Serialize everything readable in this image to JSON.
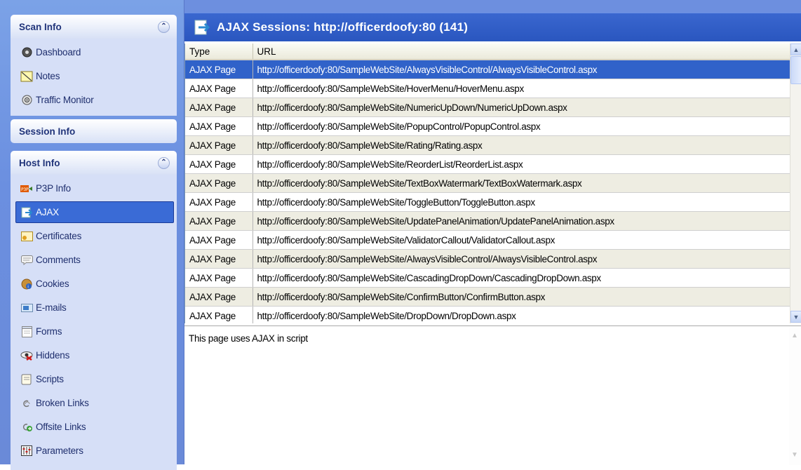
{
  "sidebar": {
    "scan_info": {
      "title": "Scan Info",
      "items": [
        {
          "label": "Dashboard",
          "icon": "dashboard-icon"
        },
        {
          "label": "Notes",
          "icon": "notes-icon"
        },
        {
          "label": "Traffic Monitor",
          "icon": "traffic-monitor-icon"
        }
      ]
    },
    "session_info": {
      "title": "Session Info"
    },
    "host_info": {
      "title": "Host Info",
      "selected": "AJAX",
      "items": [
        {
          "label": "P3P Info",
          "icon": "p3p-icon"
        },
        {
          "label": "AJAX",
          "icon": "ajax-icon"
        },
        {
          "label": "Certificates",
          "icon": "certificate-icon"
        },
        {
          "label": "Comments",
          "icon": "comment-icon"
        },
        {
          "label": "Cookies",
          "icon": "cookie-icon"
        },
        {
          "label": "E-mails",
          "icon": "email-icon"
        },
        {
          "label": "Forms",
          "icon": "form-icon"
        },
        {
          "label": "Hiddens",
          "icon": "hidden-icon"
        },
        {
          "label": "Scripts",
          "icon": "script-icon"
        },
        {
          "label": "Broken Links",
          "icon": "broken-link-icon"
        },
        {
          "label": "Offsite Links",
          "icon": "offsite-link-icon"
        },
        {
          "label": "Parameters",
          "icon": "parameters-icon"
        }
      ]
    }
  },
  "main": {
    "title": "AJAX Sessions: http://officerdoofy:80 (141)",
    "columns": [
      "Type",
      "URL"
    ],
    "rows": [
      [
        "AJAX Page",
        "http://officerdoofy:80/SampleWebSite/AlwaysVisibleControl/AlwaysVisibleControl.aspx"
      ],
      [
        "AJAX Page",
        "http://officerdoofy:80/SampleWebSite/HoverMenu/HoverMenu.aspx"
      ],
      [
        "AJAX Page",
        "http://officerdoofy:80/SampleWebSite/NumericUpDown/NumericUpDown.aspx"
      ],
      [
        "AJAX Page",
        "http://officerdoofy:80/SampleWebSite/PopupControl/PopupControl.aspx"
      ],
      [
        "AJAX Page",
        "http://officerdoofy:80/SampleWebSite/Rating/Rating.aspx"
      ],
      [
        "AJAX Page",
        "http://officerdoofy:80/SampleWebSite/ReorderList/ReorderList.aspx"
      ],
      [
        "AJAX Page",
        "http://officerdoofy:80/SampleWebSite/TextBoxWatermark/TextBoxWatermark.aspx"
      ],
      [
        "AJAX Page",
        "http://officerdoofy:80/SampleWebSite/ToggleButton/ToggleButton.aspx"
      ],
      [
        "AJAX Page",
        "http://officerdoofy:80/SampleWebSite/UpdatePanelAnimation/UpdatePanelAnimation.aspx"
      ],
      [
        "AJAX Page",
        "http://officerdoofy:80/SampleWebSite/ValidatorCallout/ValidatorCallout.aspx"
      ],
      [
        "AJAX Page",
        "http://officerdoofy:80/SampleWebSite/AlwaysVisibleControl/AlwaysVisibleControl.aspx"
      ],
      [
        "AJAX Page",
        "http://officerdoofy:80/SampleWebSite/CascadingDropDown/CascadingDropDown.aspx"
      ],
      [
        "AJAX Page",
        "http://officerdoofy:80/SampleWebSite/ConfirmButton/ConfirmButton.aspx"
      ],
      [
        "AJAX Page",
        "http://officerdoofy:80/SampleWebSite/DropDown/DropDown.aspx"
      ]
    ],
    "selected_row": 0,
    "detail_text": "This page uses AJAX in script"
  },
  "colors": {
    "title_bar": "#2a56bf",
    "selection": "#3062c9",
    "pane_bg": "#d6dff7",
    "alt_row": "#eeede2"
  }
}
